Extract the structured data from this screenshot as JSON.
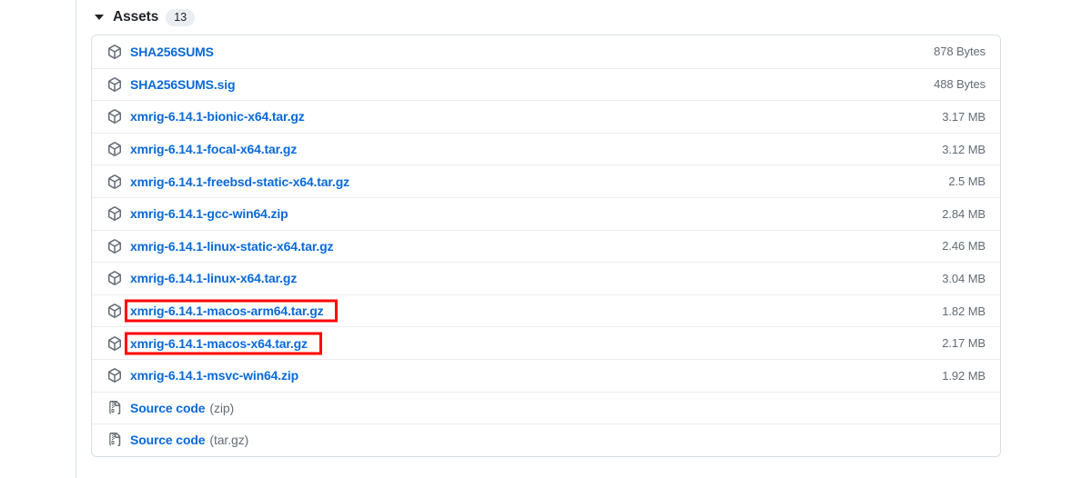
{
  "assets": {
    "label": "Assets",
    "count": "13",
    "expanded_icon": "chevron-down-icon",
    "rows": [
      {
        "icon": "package-icon",
        "name": "SHA256SUMS",
        "suffix": "",
        "size": "878 Bytes",
        "annotated": false
      },
      {
        "icon": "package-icon",
        "name": "SHA256SUMS.sig",
        "suffix": "",
        "size": "488 Bytes",
        "annotated": false
      },
      {
        "icon": "package-icon",
        "name": "xmrig-6.14.1-bionic-x64.tar.gz",
        "suffix": "",
        "size": "3.17 MB",
        "annotated": false
      },
      {
        "icon": "package-icon",
        "name": "xmrig-6.14.1-focal-x64.tar.gz",
        "suffix": "",
        "size": "3.12 MB",
        "annotated": false
      },
      {
        "icon": "package-icon",
        "name": "xmrig-6.14.1-freebsd-static-x64.tar.gz",
        "suffix": "",
        "size": "2.5 MB",
        "annotated": false
      },
      {
        "icon": "package-icon",
        "name": "xmrig-6.14.1-gcc-win64.zip",
        "suffix": "",
        "size": "2.84 MB",
        "annotated": false
      },
      {
        "icon": "package-icon",
        "name": "xmrig-6.14.1-linux-static-x64.tar.gz",
        "suffix": "",
        "size": "2.46 MB",
        "annotated": false
      },
      {
        "icon": "package-icon",
        "name": "xmrig-6.14.1-linux-x64.tar.gz",
        "suffix": "",
        "size": "3.04 MB",
        "annotated": false
      },
      {
        "icon": "package-icon",
        "name": "xmrig-6.14.1-macos-arm64.tar.gz",
        "suffix": "",
        "size": "1.82 MB",
        "annotated": true
      },
      {
        "icon": "package-icon",
        "name": "xmrig-6.14.1-macos-x64.tar.gz",
        "suffix": "",
        "size": "2.17 MB",
        "annotated": true
      },
      {
        "icon": "package-icon",
        "name": "xmrig-6.14.1-msvc-win64.zip",
        "suffix": "",
        "size": "1.92 MB",
        "annotated": false
      },
      {
        "icon": "file-zip-icon",
        "name": "Source code",
        "suffix": "(zip)",
        "size": "",
        "annotated": false
      },
      {
        "icon": "file-zip-icon",
        "name": "Source code",
        "suffix": "(tar.gz)",
        "size": "",
        "annotated": false
      }
    ]
  },
  "colors": {
    "link": "#0969da",
    "muted": "#636c76",
    "border": "#d8dee4",
    "annotation": "#ff0000",
    "text": "#1f2328"
  }
}
